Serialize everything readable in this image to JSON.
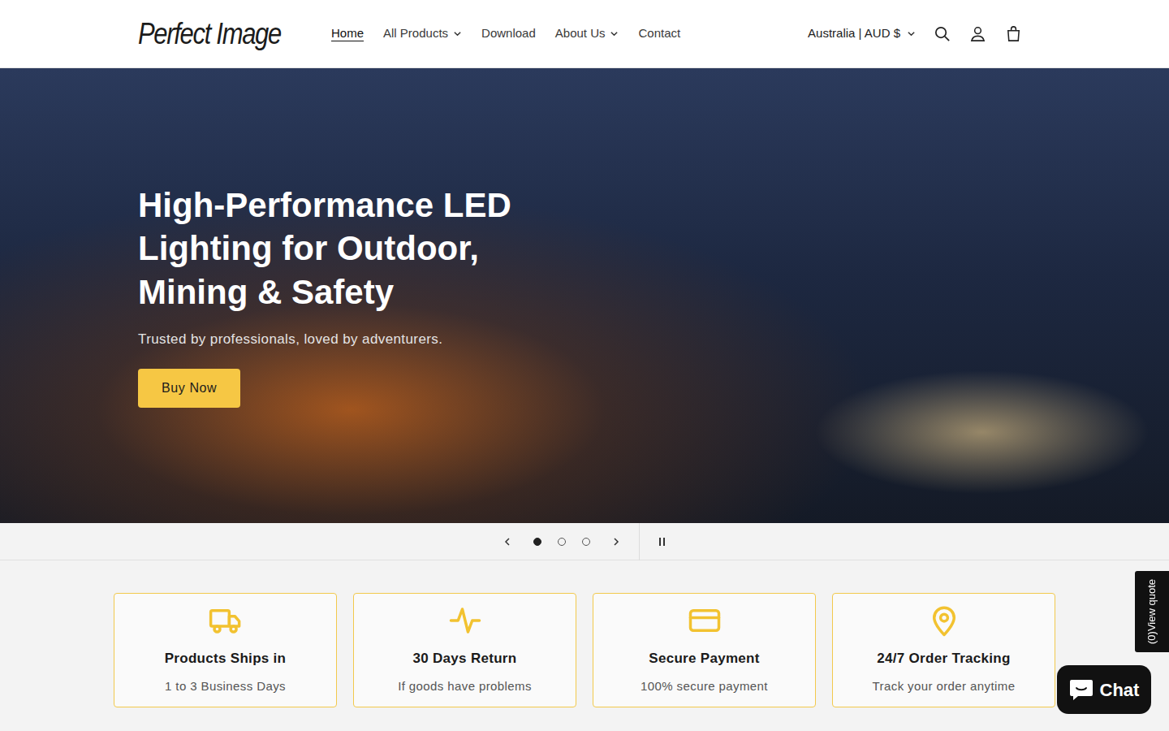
{
  "header": {
    "logo": "Perfect Image",
    "nav": [
      {
        "label": "Home",
        "selected": true,
        "dropdown": false
      },
      {
        "label": "All Products",
        "selected": false,
        "dropdown": true
      },
      {
        "label": "Download",
        "selected": false,
        "dropdown": false
      },
      {
        "label": "About Us",
        "selected": false,
        "dropdown": true
      },
      {
        "label": "Contact",
        "selected": false,
        "dropdown": false
      }
    ],
    "country": "Australia | AUD $"
  },
  "hero": {
    "title": "High-Performance LED Lighting for Outdoor, Mining & Safety",
    "subtitle": "Trusted by professionals, loved by adventurers.",
    "button": "Buy Now"
  },
  "slider": {
    "slides": [
      {
        "selected": true
      },
      {
        "selected": false
      },
      {
        "selected": false
      }
    ]
  },
  "features": [
    {
      "title": "Products Ships in",
      "text": "1 to 3 Business Days",
      "kind": "truck"
    },
    {
      "title": "30 Days Return",
      "text": "If goods have problems",
      "kind": "pulse"
    },
    {
      "title": "Secure Payment",
      "text": "100% secure payment",
      "kind": "card"
    },
    {
      "title": "24/7 Order Tracking",
      "text": "Track your order anytime",
      "kind": "pin"
    }
  ],
  "quote_tab": "(0)View quote",
  "chat": {
    "label": "Chat"
  }
}
